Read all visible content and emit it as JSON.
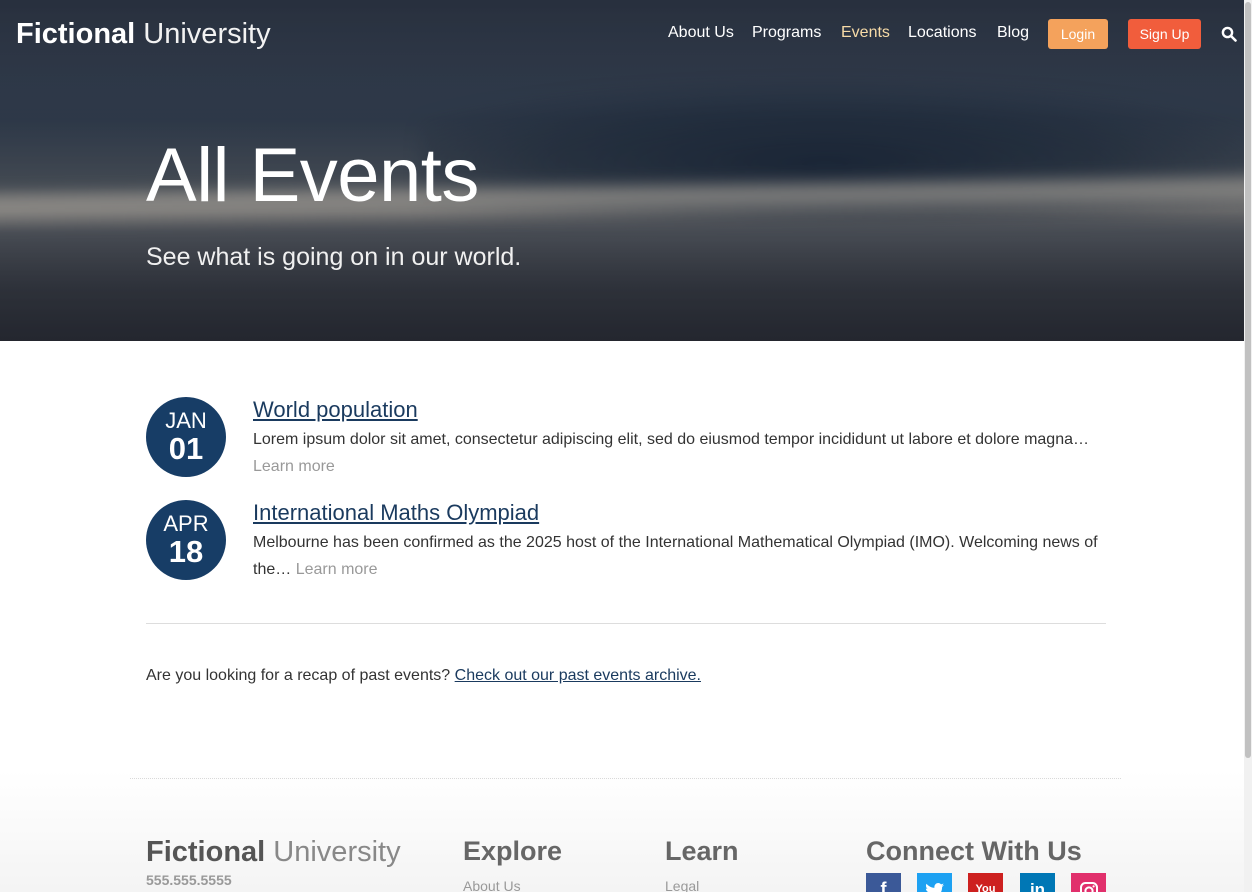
{
  "header": {
    "brand_strong": "Fictional",
    "brand_light": "University",
    "nav": [
      {
        "label": "About Us"
      },
      {
        "label": "Programs"
      },
      {
        "label": "Events"
      },
      {
        "label": "Locations"
      },
      {
        "label": "Blog"
      }
    ],
    "login_label": "Login",
    "signup_label": "Sign Up",
    "search_icon": "search-icon",
    "active_nav": "Events"
  },
  "hero": {
    "title": "All Events",
    "subtitle": "See what is going on in our world."
  },
  "events": [
    {
      "month": "JAN",
      "day": "01",
      "title": "World population",
      "excerpt": "Lorem ipsum dolor sit amet, consectetur adipiscing elit, sed do eiusmod tempor incididunt ut labore et dolore magna…",
      "learn_more": "Learn more"
    },
    {
      "month": "APR",
      "day": "18",
      "title": "International Maths Olympiad",
      "excerpt": "Melbourne has been confirmed as the 2025 host of the International Mathematical Olympiad (IMO). Welcoming news of the…",
      "learn_more": "Learn more"
    }
  ],
  "archive": {
    "text": "Are you looking for a recap of past events?",
    "link": "Check out our past events archive."
  },
  "footer": {
    "brand_strong": "Fictional",
    "brand_light": "University",
    "phone": "555.555.5555",
    "explore_heading": "Explore",
    "explore_first_link": "About Us",
    "learn_heading": "Learn",
    "learn_first_link": "Legal",
    "connect_heading": "Connect With Us",
    "social": [
      {
        "icon": "facebook-icon",
        "color": "#3b5998"
      },
      {
        "icon": "twitter-icon",
        "color": "#1da1f2"
      },
      {
        "icon": "youtube-icon",
        "color": "#cd201f"
      },
      {
        "icon": "linkedin-icon",
        "color": "#0077b5"
      },
      {
        "icon": "instagram-icon",
        "color": "#e1306c"
      }
    ]
  },
  "colors": {
    "event_badge": "#173d66",
    "login_button": "#f4a25c",
    "signup_button": "#f15d3c",
    "active_nav": "#f7dba7"
  }
}
